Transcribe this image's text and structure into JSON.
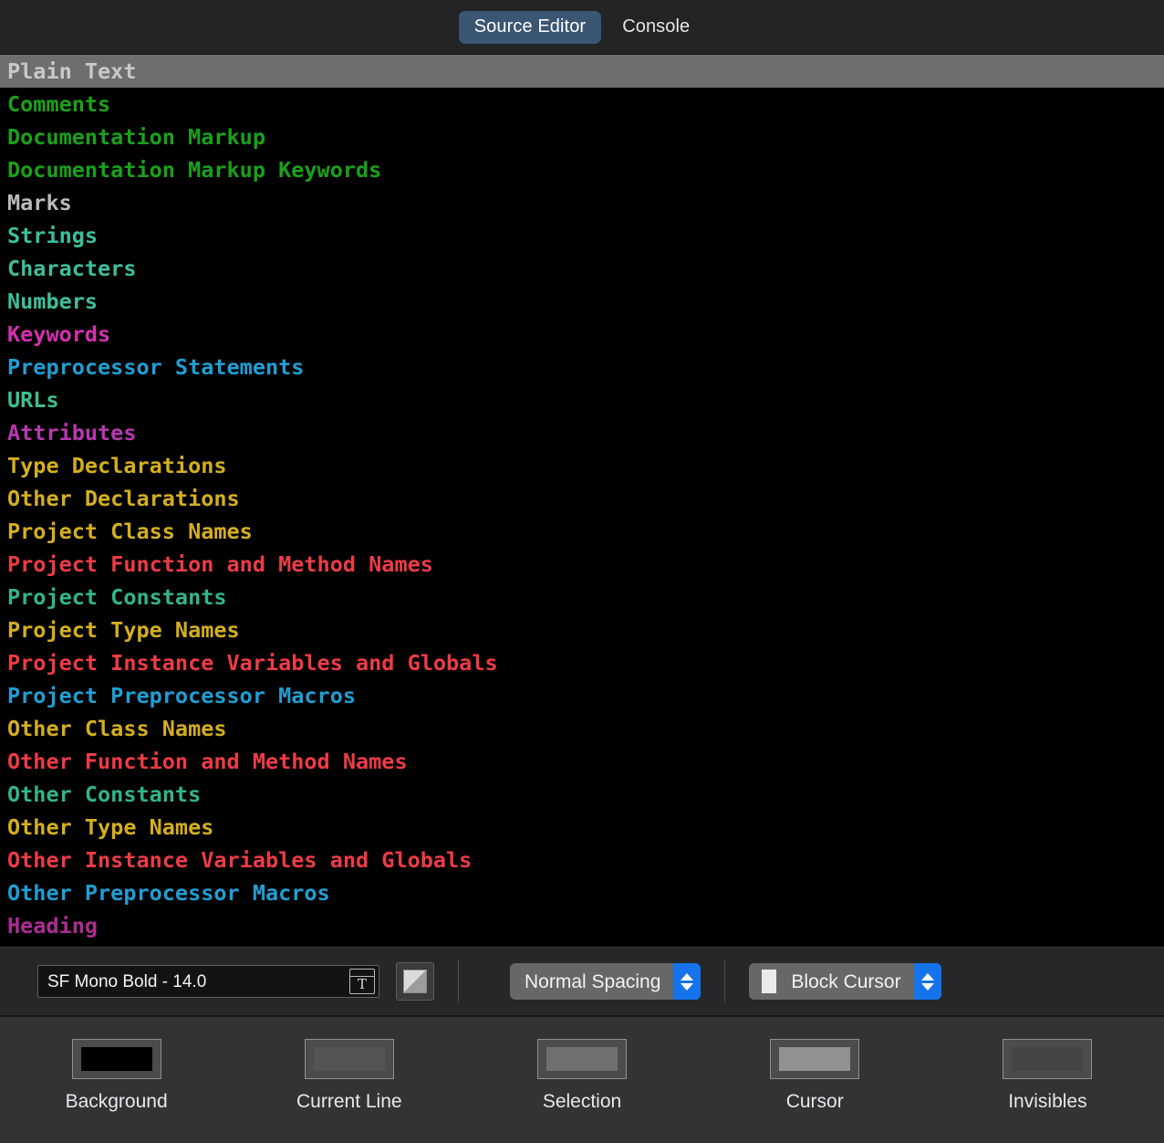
{
  "window": {
    "tabs": [
      {
        "label": "Source Editor",
        "active": true
      },
      {
        "label": "Console",
        "active": false
      }
    ]
  },
  "syntax_list": {
    "rows": [
      {
        "label": "Plain Text",
        "color": "#c8c9ca",
        "selected": true
      },
      {
        "label": "Comments",
        "color": "#1aa11a",
        "selected": false
      },
      {
        "label": "Documentation Markup",
        "color": "#1aa11a",
        "selected": false
      },
      {
        "label": "Documentation Markup Keywords",
        "color": "#1aa11a",
        "selected": false
      },
      {
        "label": "Marks",
        "color": "#b9babb",
        "selected": false
      },
      {
        "label": "Strings",
        "color": "#3dbf9c",
        "selected": false
      },
      {
        "label": "Characters",
        "color": "#3dbf9c",
        "selected": false
      },
      {
        "label": "Numbers",
        "color": "#3dbf9c",
        "selected": false
      },
      {
        "label": "Keywords",
        "color": "#d62fb0",
        "selected": false
      },
      {
        "label": "Preprocessor Statements",
        "color": "#1f9fd4",
        "selected": false
      },
      {
        "label": "URLs",
        "color": "#3dbf8e",
        "selected": false
      },
      {
        "label": "Attributes",
        "color": "#b838b0",
        "selected": false
      },
      {
        "label": "Type Declarations",
        "color": "#d4af1f",
        "selected": false
      },
      {
        "label": "Other Declarations",
        "color": "#d4af1f",
        "selected": false
      },
      {
        "label": "Project Class Names",
        "color": "#d4af1f",
        "selected": false
      },
      {
        "label": "Project Function and Method Names",
        "color": "#ee3b46",
        "selected": false
      },
      {
        "label": "Project Constants",
        "color": "#32b58a",
        "selected": false
      },
      {
        "label": "Project Type Names",
        "color": "#d4af1f",
        "selected": false
      },
      {
        "label": "Project Instance Variables and Globals",
        "color": "#ee3b46",
        "selected": false
      },
      {
        "label": "Project Preprocessor Macros",
        "color": "#1f9fd4",
        "selected": false
      },
      {
        "label": "Other Class Names",
        "color": "#d4af1f",
        "selected": false
      },
      {
        "label": "Other Function and Method Names",
        "color": "#ee3b46",
        "selected": false
      },
      {
        "label": "Other Constants",
        "color": "#32b58a",
        "selected": false
      },
      {
        "label": "Other Type Names",
        "color": "#d4af1f",
        "selected": false
      },
      {
        "label": "Other Instance Variables and Globals",
        "color": "#ee3b46",
        "selected": false
      },
      {
        "label": "Other Preprocessor Macros",
        "color": "#1f9fd4",
        "selected": false
      },
      {
        "label": "Heading",
        "color": "#ad2d92",
        "selected": false
      }
    ]
  },
  "toolbar": {
    "font_value": "SF Mono Bold - 14.0",
    "font_panel_icon": "font-panel-icon",
    "font_panel_glyph": "T",
    "color_chip_icon": "color-swatch-icon",
    "line_spacing": {
      "value": "Normal Spacing"
    },
    "cursor_style": {
      "value": "Block Cursor",
      "swatch_color": "#e8eaec"
    }
  },
  "swatches": [
    {
      "name": "background",
      "label": "Background",
      "color": "#000000"
    },
    {
      "name": "current-line",
      "label": "Current Line",
      "color": "#525456"
    },
    {
      "name": "selection",
      "label": "Selection",
      "color": "#6e7072"
    },
    {
      "name": "cursor",
      "label": "Cursor",
      "color": "#8f9193"
    },
    {
      "name": "invisibles",
      "label": "Invisibles",
      "color": "#434547"
    }
  ]
}
